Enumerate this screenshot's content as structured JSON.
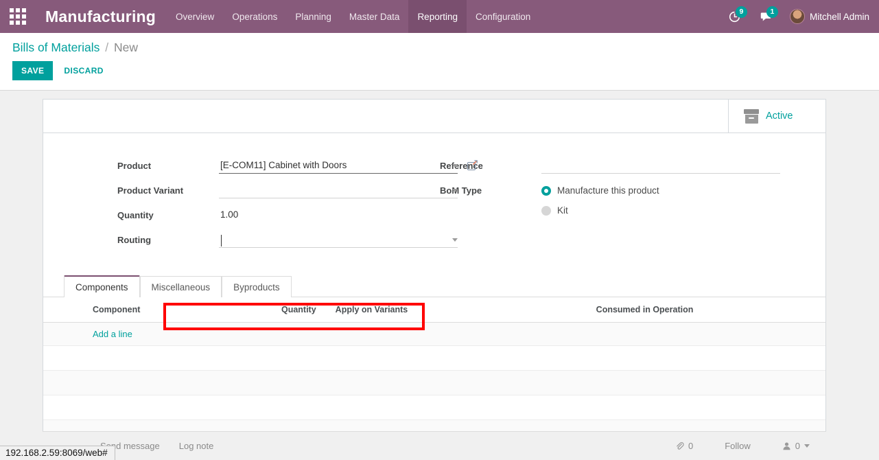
{
  "navbar": {
    "apps_icon": "apps-grid-icon",
    "brand": "Manufacturing",
    "menu": [
      {
        "label": "Overview",
        "active": false
      },
      {
        "label": "Operations",
        "active": false
      },
      {
        "label": "Planning",
        "active": false
      },
      {
        "label": "Master Data",
        "active": false
      },
      {
        "label": "Reporting",
        "active": true
      },
      {
        "label": "Configuration",
        "active": false
      }
    ],
    "activity_icon": "clock-activity-icon",
    "activity_count": "9",
    "messages_icon": "chat-bubble-icon",
    "messages_count": "1",
    "user_name": "Mitchell Admin",
    "accent": "#875A7B",
    "badge_color": "#00A09D"
  },
  "control_panel": {
    "breadcrumb_root": "Bills of Materials",
    "breadcrumb_sep": "/",
    "breadcrumb_current": "New",
    "save_label": "SAVE",
    "discard_label": "DISCARD"
  },
  "sheet": {
    "stat_button": {
      "icon": "archive-box-icon",
      "label": "Active"
    },
    "fields_left": [
      {
        "label": "Product",
        "value": "[E-COM11] Cabinet with Doors",
        "placeholder": "",
        "type": "many2one",
        "filled": true
      },
      {
        "label": "Product Variant",
        "value": "",
        "placeholder": "",
        "type": "many2one",
        "filled": false
      },
      {
        "label": "Quantity",
        "value": "1.00",
        "placeholder": "",
        "type": "text",
        "filled": false
      },
      {
        "label": "Routing",
        "value": "",
        "placeholder": "",
        "type": "many2one",
        "filled": false
      }
    ],
    "fields_right": {
      "reference_label": "Reference",
      "reference_value": "",
      "bom_type_label": "BoM Type",
      "bom_type_options": [
        {
          "label": "Manufacture this product",
          "selected": true
        },
        {
          "label": "Kit",
          "selected": false
        }
      ]
    },
    "highlight_color": "#FF0000"
  },
  "notebook": {
    "tabs": [
      {
        "label": "Components",
        "active": true
      },
      {
        "label": "Miscellaneous",
        "active": false
      },
      {
        "label": "Byproducts",
        "active": false
      }
    ],
    "columns": [
      "Component",
      "Quantity",
      "Apply on Variants",
      "Consumed in Operation"
    ],
    "rows": [],
    "add_line_label": "Add a line"
  },
  "chatter": {
    "send_message": "Send message",
    "log_note": "Log note",
    "attachment_icon": "paperclip-icon",
    "attachment_count": "0",
    "follow_label": "Follow",
    "followers_icon": "user-icon",
    "followers_count": "0"
  },
  "status_bar": {
    "url": "192.168.2.59:8069/web#"
  }
}
